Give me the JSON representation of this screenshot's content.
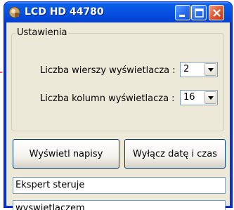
{
  "window": {
    "title": "LCD HD 44780"
  },
  "settings": {
    "group_label": "Ustawienia",
    "rows_label": "Liczba wierszy wyświetlacza :",
    "rows_value": "2",
    "cols_label": "Liczba kolumn wyświetlacza :",
    "cols_value": "16"
  },
  "buttons": {
    "show_text": "Wyświetl napisy",
    "toggle_datetime": "Wyłącz datę i czas"
  },
  "fields": {
    "line1": "Ekspert steruje",
    "line2": "wyswietlaczem"
  },
  "colors": {
    "title_bar": "#0a5fe6",
    "annotation": "#e0261c"
  },
  "icons": {
    "app": "app-icon",
    "minimize": "minimize-icon",
    "maximize": "maximize-icon",
    "close": "close-icon",
    "dropdown": "chevron-down-icon"
  }
}
